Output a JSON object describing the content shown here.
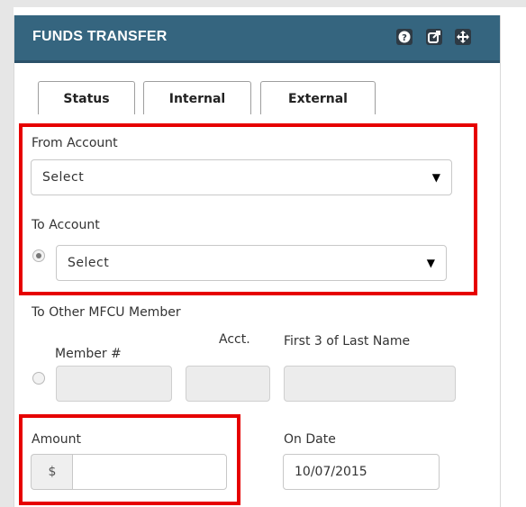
{
  "header": {
    "title": "FUNDS TRANSFER",
    "icons": [
      "help-icon",
      "popout-icon",
      "move-icon"
    ],
    "background_color": "#35657f"
  },
  "tabs": [
    {
      "label": "Status"
    },
    {
      "label": "Internal"
    },
    {
      "label": "External"
    }
  ],
  "from_account": {
    "label": "From Account",
    "selected": "Select"
  },
  "to_account": {
    "label": "To Account",
    "selected": "Select",
    "radio_checked": true
  },
  "other_member": {
    "label": "To Other MFCU Member",
    "radio_checked": false,
    "member_label": "Member #",
    "acct_label": "Acct.",
    "last_name_label": "First 3 of Last Name",
    "member_value": "",
    "acct_value": "",
    "last_name_value": ""
  },
  "amount": {
    "label": "Amount",
    "currency_symbol": "$",
    "value": ""
  },
  "on_date": {
    "label": "On Date",
    "value": "10/07/2015"
  },
  "highlight_color": "#e60000"
}
